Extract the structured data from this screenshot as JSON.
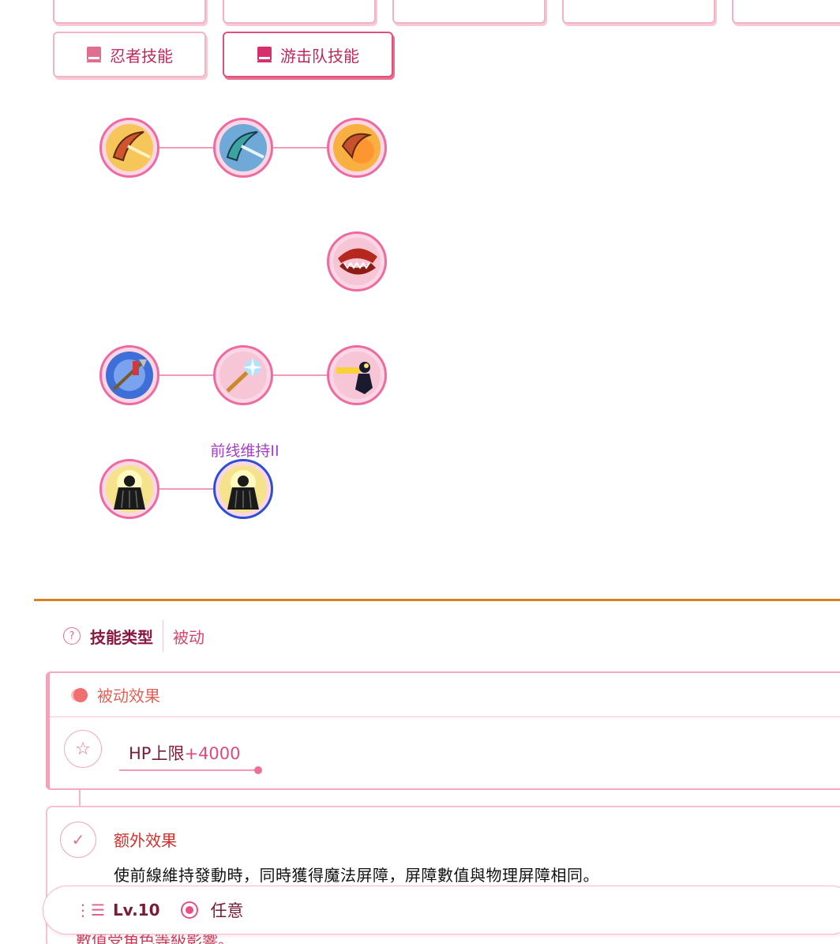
{
  "category_tabs": [
    {
      "label": "忍者技能",
      "active": false
    },
    {
      "label": "游击队技能",
      "active": true
    }
  ],
  "skill_tree": {
    "selected_label": "前线维持II",
    "rows": [
      [
        "boomerang-icon",
        "boomerang-icon",
        "boomerang-icon"
      ],
      [
        "trap-jaws-icon"
      ],
      [
        "arrow-icon",
        "arrow-icon",
        "dash-figure-icon"
      ],
      [
        "cloak-figure-icon",
        "cloak-figure-icon"
      ]
    ]
  },
  "skill_type": {
    "label": "技能类型",
    "value": "被动"
  },
  "passive": {
    "title": "被动效果",
    "effect_name": "HP上限",
    "effect_value": "+4000"
  },
  "extra": {
    "title": "额外效果",
    "description": "使前線維持發動時，同時獲得魔法屏障，屏障數值與物理屏障相同。",
    "note": "數值受角色等級影響。"
  },
  "level_bar": {
    "level": "Lv.10",
    "option": "任意"
  },
  "colors": {
    "accent": "#e84f82",
    "node_border": "#ef6aa0",
    "selected_border": "#2d4fd6",
    "divider": "#d9801f"
  }
}
